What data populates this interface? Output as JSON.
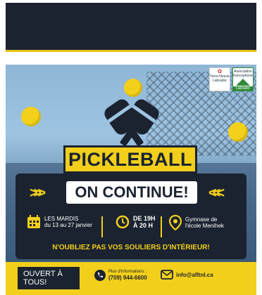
{
  "poster": {
    "title": "PICKLEBALL",
    "subtitle": "ON CONTINUE!",
    "logos": {
      "left_lines": [
        "Terre-Neuve",
        "Labrador"
      ],
      "right_lines": [
        "Association",
        "francophone",
        "Labrador"
      ]
    },
    "schedule": {
      "day": "LES MARDIS",
      "dates": "du 13 au 27 janvier",
      "time_start": "DE 19H",
      "time_end": "À 20 H",
      "location_line1": "Gymnase de",
      "location_line2": "l'école Menihek"
    },
    "reminder": "N'OUBLIEZ PAS VOS SOULIERS D'INTÉRIEUR!",
    "footer": {
      "open_label": "OUVERT À TOUS!",
      "phone_label": "Plus d'informations :",
      "phone": "(709) 944-6600",
      "email": "info@afltnl.ca"
    },
    "colors": {
      "navy": "#1b2330",
      "yellow": "#f2cf1a",
      "white": "#ffffff",
      "green": "#2e8b3a"
    }
  }
}
